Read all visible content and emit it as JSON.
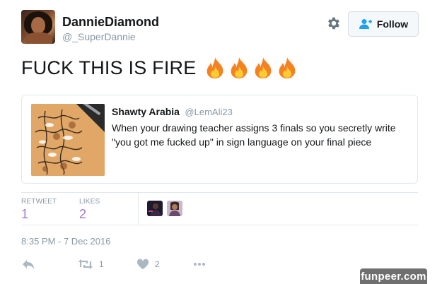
{
  "author": {
    "display_name": "DannieDiamond",
    "handle": "@_SuperDannie"
  },
  "follow_button": {
    "label": "Follow"
  },
  "tweet": {
    "text": "FUCK THIS IS FIRE",
    "emoji": [
      "fire-emoji",
      "fire-emoji",
      "fire-emoji",
      "fire-emoji"
    ]
  },
  "quoted_tweet": {
    "name": "Shawty Arabia",
    "handle": "@LemAli23",
    "text": "When your drawing teacher assigns 3 finals so you secretly write \"you got me fucked up\" in sign language on your final piece"
  },
  "stats": {
    "retweets_label": "RETWEET",
    "retweets_value": "1",
    "likes_label": "LIKES",
    "likes_value": "2"
  },
  "timestamp": "8:35 PM - 7 Dec 2016",
  "actions": {
    "retweet_count": "1",
    "like_count": "2"
  },
  "watermark": "funpeer.com",
  "colors": {
    "stat_value": "#a478c8",
    "muted_text": "#8899a6",
    "border": "#e1e8ed",
    "follow_icon": "#1da1f2"
  },
  "icons": [
    "gear-icon",
    "follow-person-icon",
    "reply-icon",
    "retweet-icon",
    "heart-icon",
    "more-icon"
  ]
}
